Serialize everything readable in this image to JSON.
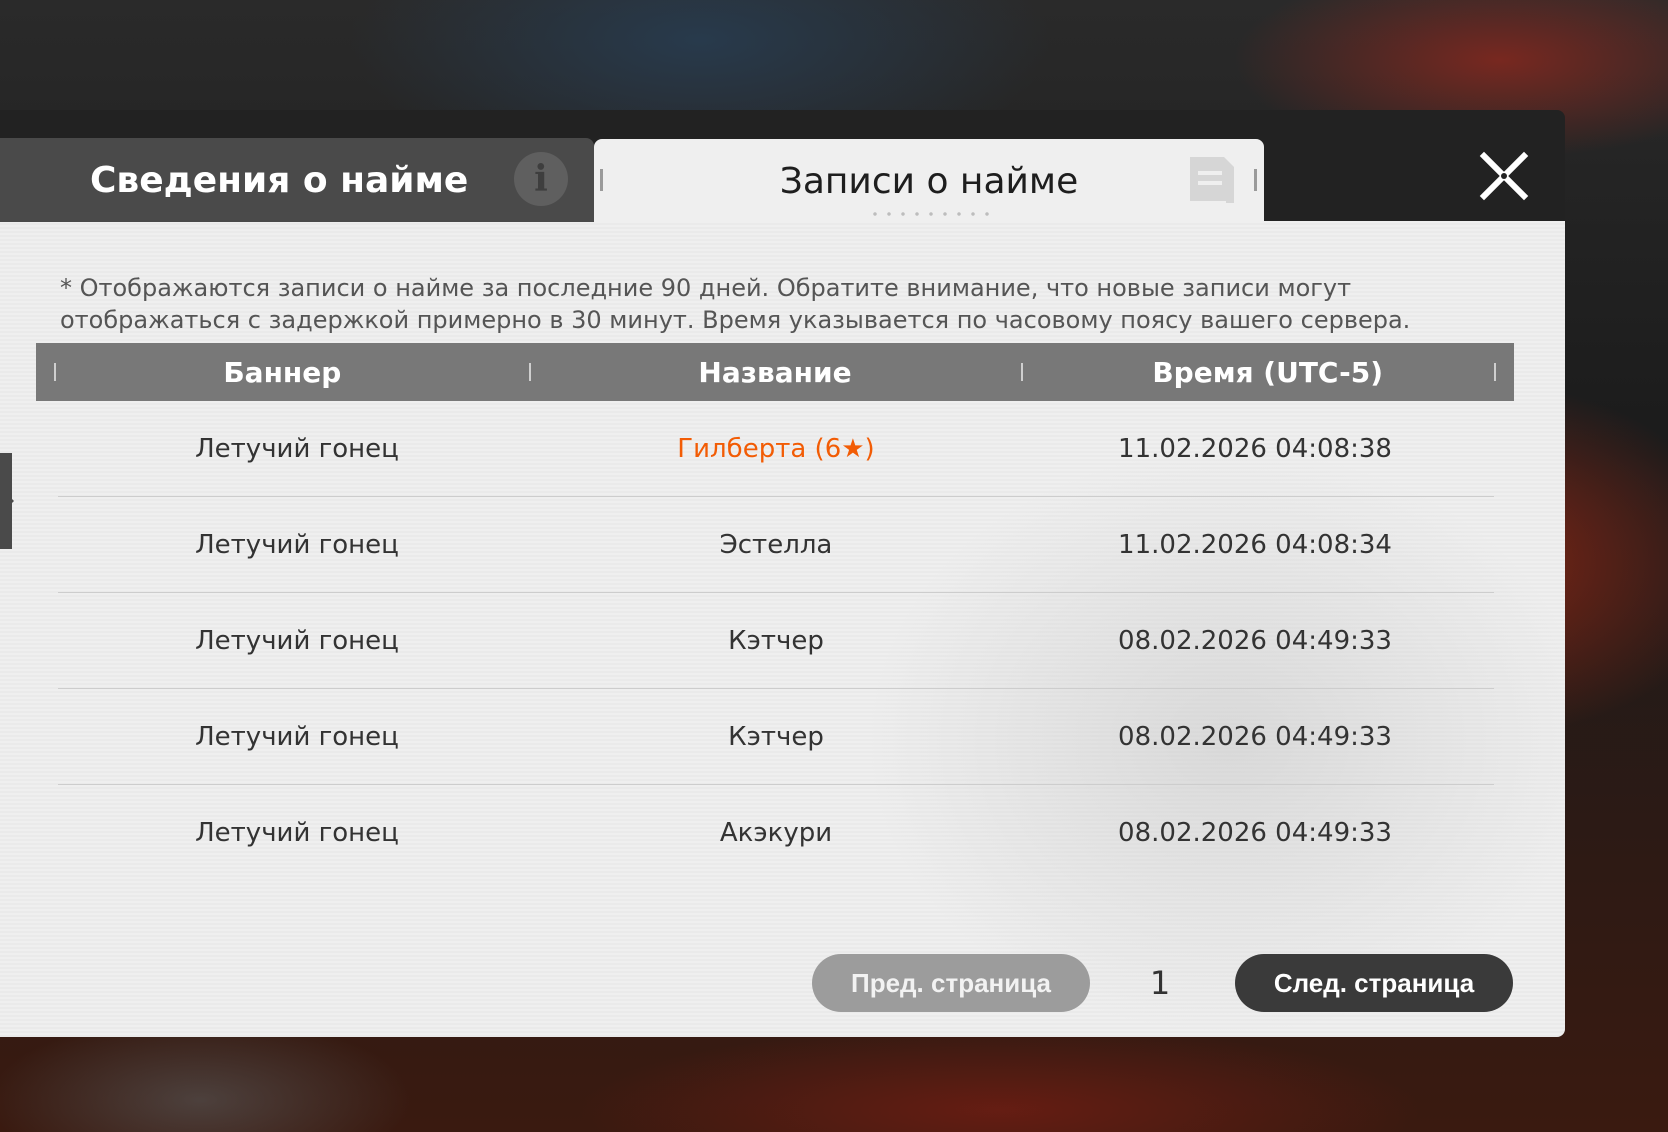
{
  "tabs": {
    "recruit_info": "Сведения о найме",
    "recruit_records": "Записи о найме"
  },
  "notice": "* Отображаются записи о найме за последние 90 дней. Обратите внимание, что новые записи могут отображаться с задержкой примерно в 30 минут. Время указывается по часовому поясу вашего сервера.",
  "table": {
    "headers": {
      "banner": "Баннер",
      "name": "Название",
      "time": "Время (UTC-5)"
    },
    "rows": [
      {
        "banner": "Летучий гонец",
        "name": "Гилберта (6★)",
        "time": "11.02.2026 04:08:38",
        "highlight": true
      },
      {
        "banner": "Летучий гонец",
        "name": "Эстелла",
        "time": "11.02.2026 04:08:34",
        "highlight": false
      },
      {
        "banner": "Летучий гонец",
        "name": "Кэтчер",
        "time": "08.02.2026 04:49:33",
        "highlight": false
      },
      {
        "banner": "Летучий гонец",
        "name": "Кэтчер",
        "time": "08.02.2026 04:49:33",
        "highlight": false
      },
      {
        "banner": "Летучий гонец",
        "name": "Акэкури",
        "time": "08.02.2026 04:49:33",
        "highlight": false
      }
    ]
  },
  "pagination": {
    "prev_label": "Пред. страница",
    "page": "1",
    "next_label": "След. страница"
  },
  "colors": {
    "highlight": "#f25c05",
    "header_bg": "#787878",
    "panel_bg": "#efefef"
  },
  "icons": {
    "info": "info-icon",
    "record": "document-icon",
    "close": "close-icon"
  }
}
